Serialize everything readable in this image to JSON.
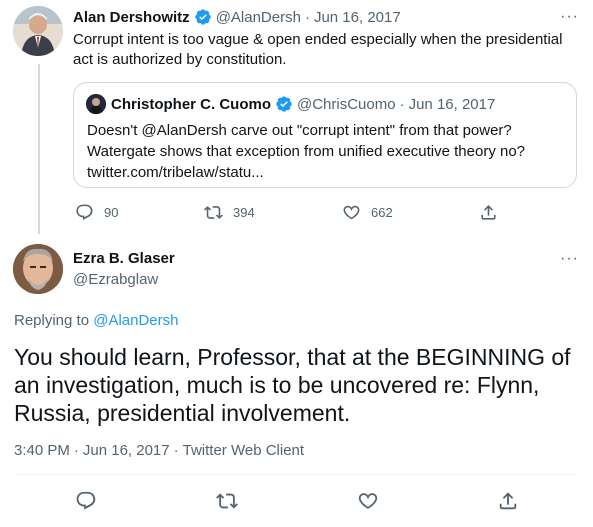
{
  "parent_tweet": {
    "author_name": "Alan Dershowitz",
    "handle": "@AlanDersh",
    "separator": "·",
    "date": "Jun 16, 2017",
    "text_line1": "Corrupt intent is too vague & open ended especially when the presidential",
    "text_line2": "act is authorized by constitution.",
    "more_label": "···",
    "verified": true,
    "quote": {
      "author_name": "Christopher C. Cuomo",
      "handle": "@ChrisCuomo",
      "separator": "·",
      "date": "Jun 16, 2017",
      "text_line1": "Doesn't @AlanDersh carve out \"corrupt intent\" from that power?",
      "text_line2": "Watergate shows that exception from unified executive theory no?",
      "text_line3": "twitter.com/tribelaw/statu..."
    },
    "actions": {
      "reply_count": "90",
      "retweet_count": "394",
      "like_count": "662"
    }
  },
  "main_tweet": {
    "author_name": "Ezra B. Glaser",
    "handle": "@Ezrabglaw",
    "more_label": "···",
    "replying_prefix": "Replying to",
    "replying_to": "@AlanDersh",
    "text_line1": "You should learn, Professor, that at the BEGINNING of",
    "text_line2": "an investigation, much is to be uncovered re: Flynn,",
    "text_line3": "Russia, presidential involvement.",
    "time": "3:40 PM",
    "date": "Jun 16, 2017",
    "source": "Twitter Web Client",
    "separator": "·"
  },
  "colors": {
    "accent": "#1d9bf0",
    "muted": "#536471",
    "text": "#0f1419",
    "border": "#cfd9de"
  },
  "icons": [
    "reply-icon",
    "retweet-icon",
    "like-icon",
    "share-icon",
    "verified-badge-icon",
    "more-icon"
  ]
}
